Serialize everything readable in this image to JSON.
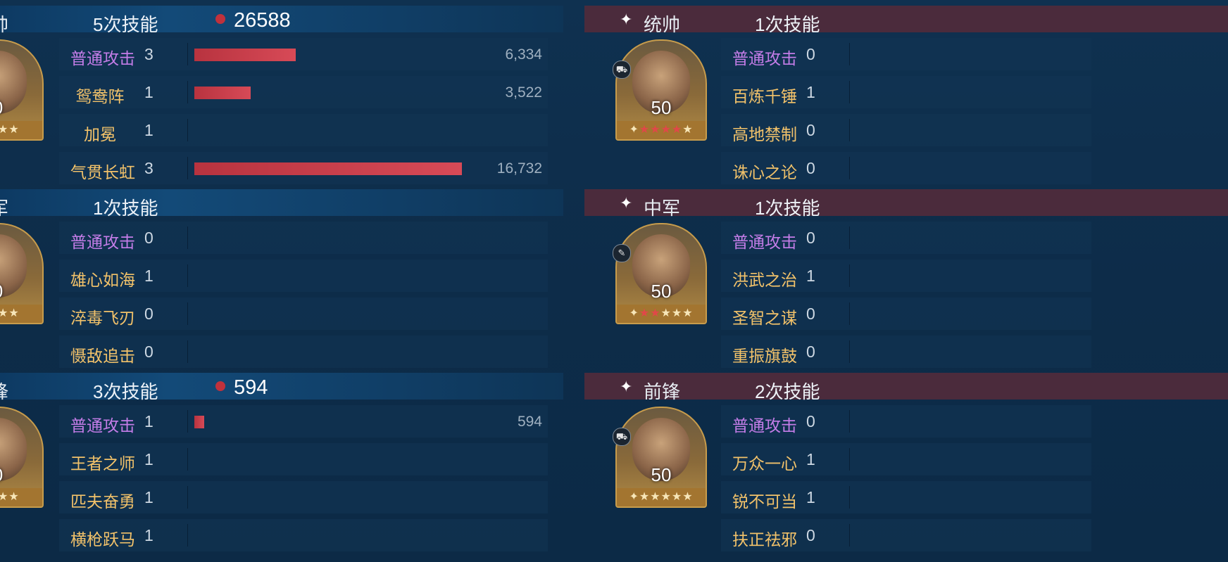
{
  "left": {
    "groups": [
      {
        "role": "帅",
        "count": "5次技能",
        "damage": "26588",
        "level": "0",
        "skills": [
          {
            "name": "普通攻击",
            "n": "3",
            "value": "6,334",
            "bar": 0.38,
            "basic": true
          },
          {
            "name": "鸳鸯阵",
            "n": "1",
            "value": "3,522",
            "bar": 0.21,
            "basic": false
          },
          {
            "name": "加冕",
            "n": "1",
            "value": "",
            "bar": 0,
            "basic": false
          },
          {
            "name": "气贯长虹",
            "n": "3",
            "value": "16,732",
            "bar": 1.0,
            "basic": false
          }
        ]
      },
      {
        "role": "军",
        "count": "1次技能",
        "damage": "",
        "level": "0",
        "skills": [
          {
            "name": "普通攻击",
            "n": "0",
            "value": "",
            "bar": 0,
            "basic": true
          },
          {
            "name": "雄心如海",
            "n": "1",
            "value": "",
            "bar": 0,
            "basic": false
          },
          {
            "name": "淬毒飞刃",
            "n": "0",
            "value": "",
            "bar": 0,
            "basic": false
          },
          {
            "name": "慑敌追击",
            "n": "0",
            "value": "",
            "bar": 0,
            "basic": false
          }
        ]
      },
      {
        "role": "锋",
        "count": "3次技能",
        "damage": "594",
        "level": "0",
        "skills": [
          {
            "name": "普通攻击",
            "n": "1",
            "value": "594",
            "bar": 0.035,
            "basic": true
          },
          {
            "name": "王者之师",
            "n": "1",
            "value": "",
            "bar": 0,
            "basic": false
          },
          {
            "name": "匹夫奋勇",
            "n": "1",
            "value": "",
            "bar": 0,
            "basic": false
          },
          {
            "name": "横枪跃马",
            "n": "1",
            "value": "",
            "bar": 0,
            "basic": false
          }
        ]
      }
    ]
  },
  "right": {
    "groups": [
      {
        "role": "统帅",
        "count": "1次技能",
        "level": "50",
        "stars_red": 4,
        "skills": [
          {
            "name": "普通攻击",
            "n": "0",
            "basic": true
          },
          {
            "name": "百炼千锤",
            "n": "1",
            "basic": false
          },
          {
            "name": "高地禁制",
            "n": "0",
            "basic": false
          },
          {
            "name": "诛心之论",
            "n": "0",
            "basic": false
          }
        ]
      },
      {
        "role": "中军",
        "count": "1次技能",
        "level": "50",
        "stars_red": 2,
        "skills": [
          {
            "name": "普通攻击",
            "n": "0",
            "basic": true
          },
          {
            "name": "洪武之治",
            "n": "1",
            "basic": false
          },
          {
            "name": "圣智之谋",
            "n": "0",
            "basic": false
          },
          {
            "name": "重振旗鼓",
            "n": "0",
            "basic": false
          }
        ]
      },
      {
        "role": "前锋",
        "count": "2次技能",
        "level": "50",
        "stars_red": 0,
        "skills": [
          {
            "name": "普通攻击",
            "n": "0",
            "basic": true
          },
          {
            "name": "万众一心",
            "n": "1",
            "basic": false
          },
          {
            "name": "锐不可当",
            "n": "1",
            "basic": false
          },
          {
            "name": "扶正祛邪",
            "n": "0",
            "basic": false
          }
        ]
      }
    ]
  },
  "colors": {
    "basic_skill": "#c47de8",
    "skill": "#f2c26a",
    "damage_bar": "#c23a47",
    "right_header": "#4b2b3c"
  }
}
